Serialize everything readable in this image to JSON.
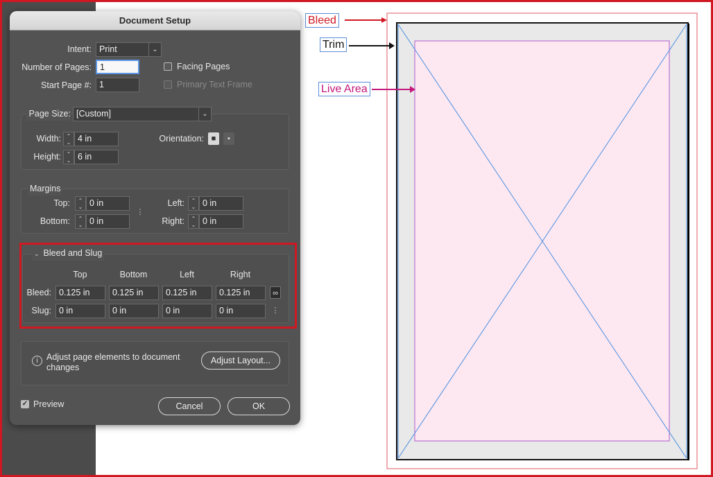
{
  "dialog": {
    "title": "Document Setup",
    "intent_label": "Intent:",
    "intent_value": "Print",
    "num_pages_label": "Number of Pages:",
    "num_pages_value": "1",
    "start_page_label": "Start Page #:",
    "start_page_value": "1",
    "facing_pages_label": "Facing Pages",
    "primary_text_frame_label": "Primary Text Frame",
    "page_size_label": "Page Size:",
    "page_size_value": "[Custom]",
    "width_label": "Width:",
    "width_value": "4 in",
    "height_label": "Height:",
    "height_value": "6 in",
    "orientation_label": "Orientation:",
    "margins": {
      "title": "Margins",
      "top_label": "Top:",
      "top_value": "0 in",
      "bottom_label": "Bottom:",
      "bottom_value": "0 in",
      "left_label": "Left:",
      "left_value": "0 in",
      "right_label": "Right:",
      "right_value": "0 in"
    },
    "bleed_slug": {
      "title": "Bleed and Slug",
      "columns": [
        "Top",
        "Bottom",
        "Left",
        "Right"
      ],
      "bleed_label": "Bleed:",
      "bleed_values": [
        "0.125 in",
        "0.125 in",
        "0.125 in",
        "0.125 in"
      ],
      "slug_label": "Slug:",
      "slug_values": [
        "0 in",
        "0 in",
        "0 in",
        "0 in"
      ]
    },
    "adjust_text": "Adjust page elements to document changes",
    "adjust_button": "Adjust Layout...",
    "preview_label": "Preview",
    "cancel_button": "Cancel",
    "ok_button": "OK"
  },
  "diagram": {
    "bleed_label": "Bleed",
    "trim_label": "Trim",
    "live_area_label": "Live Area",
    "colors": {
      "bleed": "#d01822",
      "trim": "#111111",
      "live_area": "#c2187a",
      "page_fill": "#fde8f1",
      "frame_x": "#4a8ee0"
    }
  },
  "icons": [
    "chevron-down-icon",
    "stepper-icon",
    "portrait-icon",
    "landscape-icon",
    "chain-broken-icon",
    "chain-linked-icon",
    "info-icon",
    "checkmark-icon"
  ]
}
